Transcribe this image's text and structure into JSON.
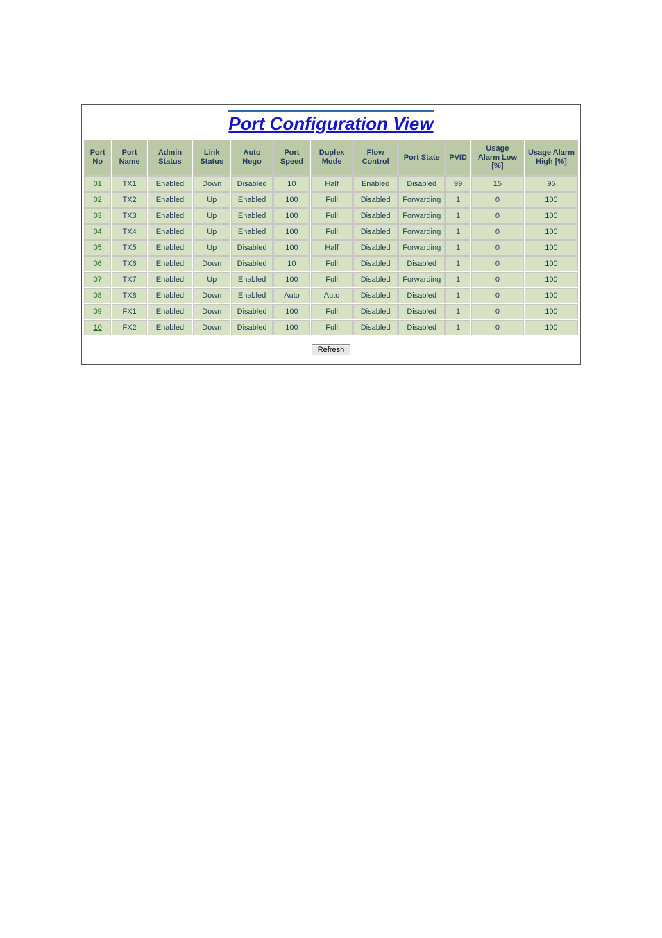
{
  "title": "Port Configuration View",
  "headers": {
    "port_no": "Port\nNo",
    "port_name": "Port\nName",
    "admin_status": "Admin\nStatus",
    "link_status": "Link\nStatus",
    "auto_nego": "Auto\nNego",
    "port_speed": "Port\nSpeed",
    "duplex_mode": "Duplex\nMode",
    "flow_control": "Flow\nControl",
    "port_state": "Port\nState",
    "pvid": "PVID",
    "usage_low": "Usage\nAlarm\nLow [%]",
    "usage_high": "Usage\nAlarm\nHigh [%]"
  },
  "rows": [
    {
      "no": "01",
      "name": "TX1",
      "admin": "Enabled",
      "link": "Down",
      "nego": "Disabled",
      "speed": "10",
      "duplex": "Half",
      "flow": "Enabled",
      "state": "Disabled",
      "pvid": "99",
      "low": "15",
      "high": "95"
    },
    {
      "no": "02",
      "name": "TX2",
      "admin": "Enabled",
      "link": "Up",
      "nego": "Enabled",
      "speed": "100",
      "duplex": "Full",
      "flow": "Disabled",
      "state": "Forwarding",
      "pvid": "1",
      "low": "0",
      "high": "100"
    },
    {
      "no": "03",
      "name": "TX3",
      "admin": "Enabled",
      "link": "Up",
      "nego": "Enabled",
      "speed": "100",
      "duplex": "Full",
      "flow": "Disabled",
      "state": "Forwarding",
      "pvid": "1",
      "low": "0",
      "high": "100"
    },
    {
      "no": "04",
      "name": "TX4",
      "admin": "Enabled",
      "link": "Up",
      "nego": "Enabled",
      "speed": "100",
      "duplex": "Full",
      "flow": "Disabled",
      "state": "Forwarding",
      "pvid": "1",
      "low": "0",
      "high": "100"
    },
    {
      "no": "05",
      "name": "TX5",
      "admin": "Enabled",
      "link": "Up",
      "nego": "Disabled",
      "speed": "100",
      "duplex": "Half",
      "flow": "Disabled",
      "state": "Forwarding",
      "pvid": "1",
      "low": "0",
      "high": "100"
    },
    {
      "no": "06",
      "name": "TX6",
      "admin": "Enabled",
      "link": "Down",
      "nego": "Disabled",
      "speed": "10",
      "duplex": "Full",
      "flow": "Disabled",
      "state": "Disabled",
      "pvid": "1",
      "low": "0",
      "high": "100"
    },
    {
      "no": "07",
      "name": "TX7",
      "admin": "Enabled",
      "link": "Up",
      "nego": "Enabled",
      "speed": "100",
      "duplex": "Full",
      "flow": "Disabled",
      "state": "Forwarding",
      "pvid": "1",
      "low": "0",
      "high": "100"
    },
    {
      "no": "08",
      "name": "TX8",
      "admin": "Enabled",
      "link": "Down",
      "nego": "Enabled",
      "speed": "Auto",
      "duplex": "Auto",
      "flow": "Disabled",
      "state": "Disabled",
      "pvid": "1",
      "low": "0",
      "high": "100"
    },
    {
      "no": "09",
      "name": "FX1",
      "admin": "Enabled",
      "link": "Down",
      "nego": "Disabled",
      "speed": "100",
      "duplex": "Full",
      "flow": "Disabled",
      "state": "Disabled",
      "pvid": "1",
      "low": "0",
      "high": "100"
    },
    {
      "no": "10",
      "name": "FX2",
      "admin": "Enabled",
      "link": "Down",
      "nego": "Disabled",
      "speed": "100",
      "duplex": "Full",
      "flow": "Disabled",
      "state": "Disabled",
      "pvid": "1",
      "low": "0",
      "high": "100"
    }
  ],
  "refresh_label": "Refresh"
}
